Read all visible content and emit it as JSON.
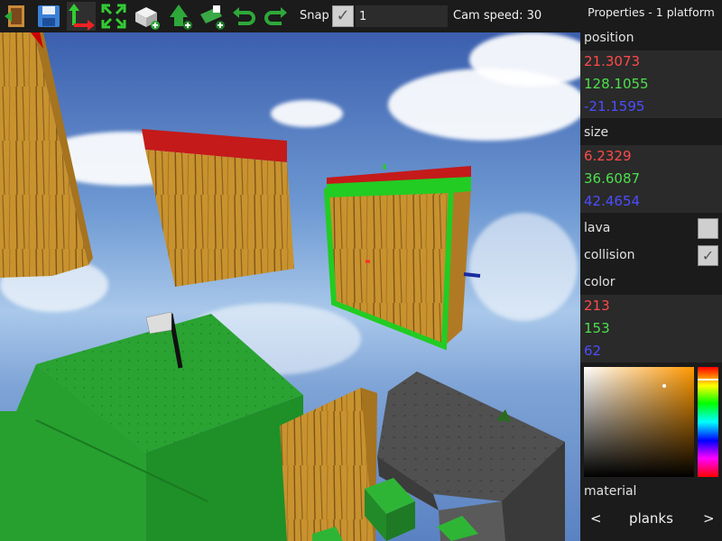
{
  "toolbar": {
    "tools": [
      "exit-icon",
      "save-icon",
      "move-tool-icon",
      "scale-tool-icon",
      "add-block-icon",
      "add-spawn-icon",
      "add-goal-icon",
      "undo-icon",
      "redo-icon"
    ],
    "snap_label": "Snap",
    "snap_checked": true,
    "snap_value": "1",
    "cam_speed_label": "Cam speed: 30"
  },
  "properties": {
    "title": "Properties - 1 platform",
    "position_label": "position",
    "position": {
      "x": "21.3073",
      "y": "128.1055",
      "z": "-21.1595"
    },
    "size_label": "size",
    "size": {
      "x": "6.2329",
      "y": "36.6087",
      "z": "42.4654"
    },
    "lava_label": "lava",
    "lava_checked": false,
    "collision_label": "collision",
    "collision_checked": true,
    "color_label": "color",
    "color": {
      "r": "213",
      "g": "153",
      "b": "62"
    },
    "material_label": "material",
    "material_prev": "<",
    "material_name": "planks",
    "material_next": ">"
  },
  "colors": {
    "axis_x": "#ff4a4a",
    "axis_y": "#4de04d",
    "axis_z": "#4d4dff",
    "selection": "#22cc22",
    "picker_hue": "#ff9900"
  }
}
